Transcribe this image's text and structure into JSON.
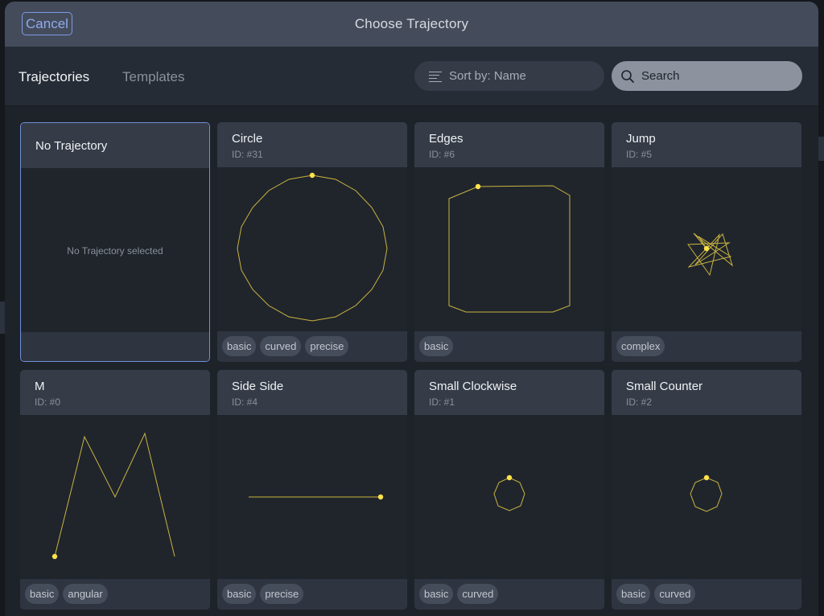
{
  "header": {
    "cancel_label": "Cancel",
    "title": "Choose Trajectory"
  },
  "tabs": {
    "trajectories": "Trajectories",
    "templates": "Templates"
  },
  "sort": {
    "label": "Sort by: Name",
    "icon": "sort-lines-icon"
  },
  "search": {
    "label": "Search",
    "icon": "search-icon"
  },
  "colors": {
    "accent": "#7b99e6",
    "trajectory": "#c9b440",
    "point": "#ffe24a"
  },
  "cards": [
    {
      "title": "No Trajectory",
      "id": "",
      "empty_text": "No Trajectory selected",
      "tags": []
    },
    {
      "title": "Circle",
      "id": "ID: #31",
      "tags": [
        "basic",
        "curved",
        "precise"
      ]
    },
    {
      "title": "Edges",
      "id": "ID: #6",
      "tags": [
        "basic"
      ]
    },
    {
      "title": "Jump",
      "id": "ID: #5",
      "tags": [
        "complex"
      ]
    },
    {
      "title": "M",
      "id": "ID: #0",
      "tags": [
        "basic",
        "angular"
      ]
    },
    {
      "title": "Side Side",
      "id": "ID: #4",
      "tags": [
        "basic",
        "precise"
      ]
    },
    {
      "title": "Small Clockwise",
      "id": "ID: #1",
      "tags": [
        "basic",
        "curved"
      ]
    },
    {
      "title": "Small Counter",
      "id": "ID: #2",
      "tags": [
        "basic",
        "curved"
      ]
    }
  ]
}
